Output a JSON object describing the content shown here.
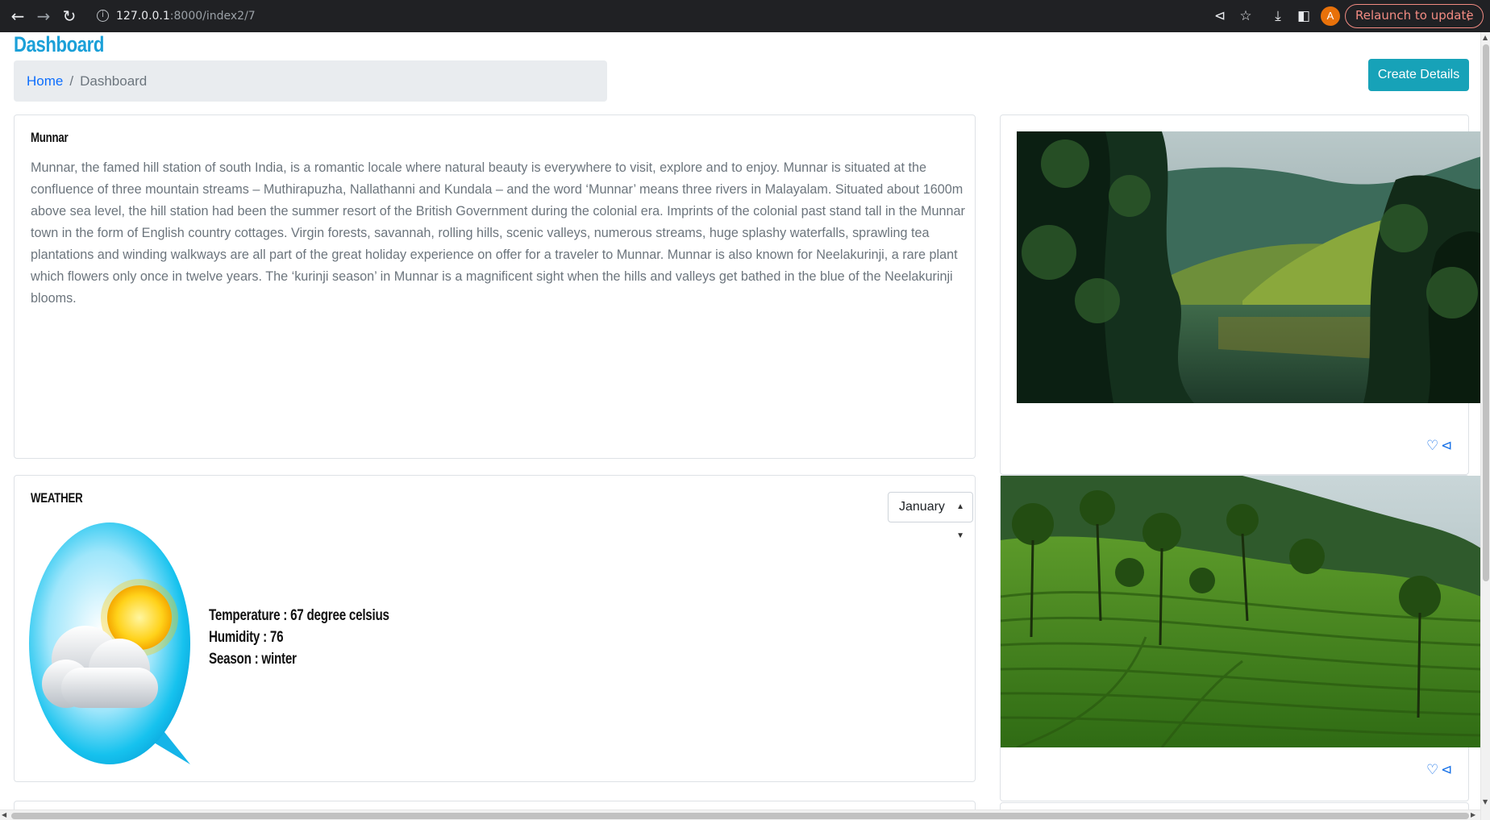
{
  "browser": {
    "url_host": "127.0.0.1",
    "url_path": ":8000/index2/7",
    "avatar_letter": "A",
    "relaunch_label": "Relaunch to update"
  },
  "page": {
    "title": "Dashboard",
    "breadcrumb": {
      "home": "Home",
      "separator": "/",
      "current": "Dashboard"
    },
    "create_button": "Create Details"
  },
  "place": {
    "name": "Munnar",
    "description": "Munnar, the famed hill station of south India, is a romantic locale where natural beauty is everywhere to visit, explore and to enjoy. Munnar is situated at the confluence of three mountain streams – Muthirapuzha, Nallathanni and Kundala – and the word ‘Munnar’ means three rivers in Malayalam. Situated about 1600m above sea level, the hill station had been the summer resort of the British Government during the colonial era. Imprints of the colonial past stand tall in the Munnar town in the form of English country cottages. Virgin forests, savannah, rolling hills, scenic valleys, numerous streams, huge splashy waterfalls, sprawling tea plantations and winding walkways are all part of the great holiday experience on offer for a traveler to Munnar. Munnar is also known for Neelakurinji, a rare plant which flowers only once in twelve years. The ‘kurinji season’ in Munnar is a magnificent sight when the hills and valleys get bathed in the blue of the Neelakurinji blooms."
  },
  "weather": {
    "title": "WEATHER",
    "month_selected": "January",
    "temperature": "Temperature : 67 degree celsius",
    "humidity": "Humidity : 76",
    "season": "Season : winter"
  },
  "colors": {
    "accent": "#1ba0d8",
    "button": "#17a2b8",
    "icon_blue": "#1a73e8"
  }
}
